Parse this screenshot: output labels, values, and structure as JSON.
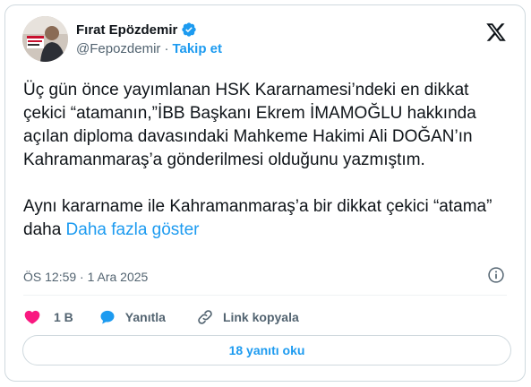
{
  "author": {
    "display_name": "Fırat Epözdemir",
    "handle": "@Fepozdemir",
    "separator": "·",
    "follow_label": "Takip et",
    "avatar_caption": "GERÇEK\nGÜNDEM"
  },
  "tweet": {
    "text": "Üç gün önce yayımlanan HSK Kararnamesi’ndeki en dikkat çekici “atamanın,”İBB Başkanı Ekrem İMAMOĞLU hakkında açılan diploma davasındaki Mahkeme Hakimi Ali DOĞAN’ın Kahramanmaraş’a gönderilmesi olduğunu yazmıştım.\n\nAynı kararname ile Kahramanmaraş’a bir dikkat çekici “atama” daha ",
    "show_more": "Daha fazla göster",
    "timestamp": "ÖS 12:59 · 1 Ara 2025"
  },
  "actions": {
    "likes": "1 B",
    "reply": "Yanıtla",
    "copy_link": "Link kopyala"
  },
  "replies_button": "18 yanıtı oku",
  "icons": {
    "verified": "verified-badge-icon",
    "x_logo": "x-logo-icon",
    "info": "info-icon",
    "like": "heart-icon",
    "reply": "speech-bubble-icon",
    "link": "link-icon"
  },
  "colors": {
    "accent": "#1d9bf0",
    "like": "#f91880",
    "text": "#0f1419",
    "muted": "#536471",
    "border": "#cfd9de"
  }
}
